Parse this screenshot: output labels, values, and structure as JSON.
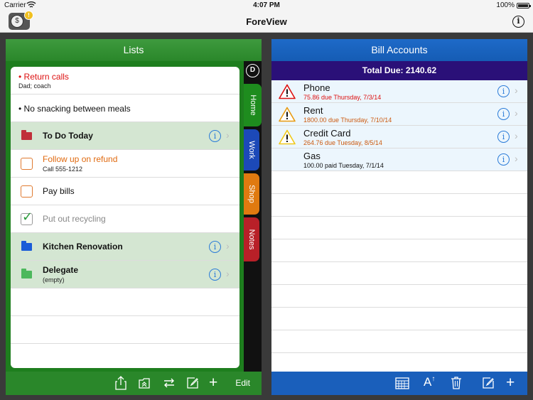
{
  "status_bar": {
    "carrier": "Carrier",
    "time": "4:07 PM",
    "battery": "100%"
  },
  "nav": {
    "title": "ForeView",
    "app_badge": "!",
    "info_icon": "info-icon"
  },
  "lists": {
    "title": "Lists",
    "rows": [
      {
        "kind": "note",
        "text": "Return calls",
        "sub": "Dad; coach",
        "color": "#dd1111"
      },
      {
        "kind": "note",
        "text": "No snacking between meals",
        "sub": ""
      },
      {
        "kind": "folder",
        "text": "To Do Today",
        "sub": "",
        "folder_color": "#c0303a"
      },
      {
        "kind": "task",
        "text": "Follow up on refund",
        "sub": "Call 555-1212",
        "checked": false
      },
      {
        "kind": "task",
        "text": "Pay bills",
        "sub": "",
        "checked": false
      },
      {
        "kind": "task",
        "text": "Put out recycling",
        "sub": "",
        "checked": true
      },
      {
        "kind": "folder",
        "text": "Kitchen Renovation",
        "sub": "",
        "folder_color": "#1a5cd8"
      },
      {
        "kind": "folder",
        "text": "Delegate",
        "sub": "(empty)",
        "folder_color": "#4cb85c"
      }
    ],
    "tabs": [
      {
        "label": "Home",
        "color": "#1e8c1e"
      },
      {
        "label": "Work",
        "color": "#1c49b8"
      },
      {
        "label": "Shop",
        "color": "#e07a10"
      },
      {
        "label": "Notes",
        "color": "#b82028"
      }
    ],
    "tab_top_icon": "D",
    "toolbar": {
      "edit": "Edit"
    }
  },
  "bills": {
    "title": "Bill Accounts",
    "total": "Total Due: 2140.62",
    "rows": [
      {
        "name": "Phone",
        "detail": "75.86 due Thursday, 7/3/14",
        "status": "overdue"
      },
      {
        "name": "Rent",
        "detail": "1800.00 due Thursday, 7/10/14",
        "status": "due"
      },
      {
        "name": "Credit Card",
        "detail": "264.76 due Tuesday, 8/5/14",
        "status": "upcoming"
      },
      {
        "name": "Gas",
        "detail": "100.00 paid Tuesday, 7/1/14",
        "status": "paid"
      }
    ]
  },
  "colors": {
    "lists_green": "#2a872a",
    "bills_blue": "#1a5fbb",
    "total_bar": "#2a1078"
  }
}
